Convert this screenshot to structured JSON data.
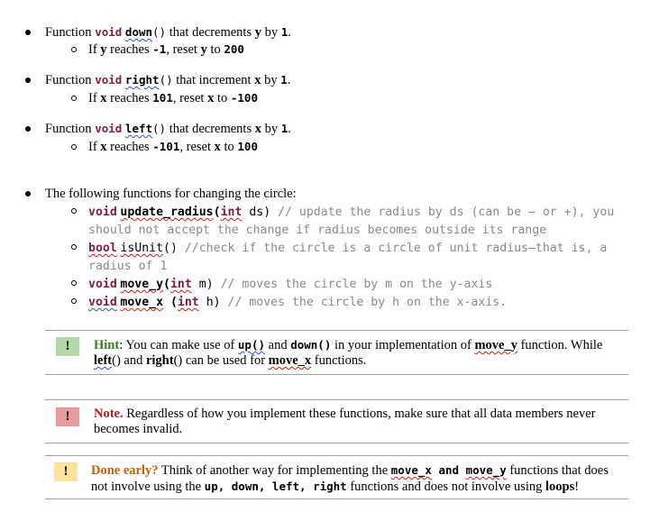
{
  "colors": {
    "keyword": "#7a1f4a",
    "comment": "#8a8a8a",
    "hint_label": "#3b7a23",
    "note_label": "#b02020",
    "done_label": "#c06010",
    "hint_icon_bg": "#b5d8a8",
    "note_icon_bg": "#e99a9c",
    "done_icon_bg": "#fde39c",
    "rule": "#a0a0a0"
  },
  "functions": [
    {
      "prefix": "Function ",
      "keyword": "void",
      "name": "down",
      "parens": "()",
      "suffix_text": " that decrements ",
      "var": "y",
      "by": " by ",
      "amount": "1",
      "end": ".",
      "sub": {
        "prefix": "If ",
        "var1": "y",
        "mid1": " reaches ",
        "val1": "-1",
        "mid2": ", reset ",
        "var2": "y",
        "mid3": " to ",
        "val2": "200"
      }
    },
    {
      "prefix": "Function ",
      "keyword": "void",
      "name": "right",
      "parens": "()",
      "suffix_text": " that increment ",
      "var": "x",
      "by": " by ",
      "amount": "1",
      "end": ".",
      "sub": {
        "prefix": "If ",
        "var1": "x",
        "mid1": " reaches ",
        "val1": "101",
        "mid2": ", reset ",
        "var2": "x",
        "mid3": " to ",
        "val2": "-100"
      }
    },
    {
      "prefix": "Function ",
      "keyword": "void",
      "name": "left",
      "parens": "()",
      "suffix_text": " that decrements ",
      "var": "x",
      "by": " by ",
      "amount": "1",
      "end": ".",
      "sub": {
        "prefix": "If ",
        "var1": "x",
        "mid1": " reaches ",
        "val1": "-101",
        "mid2": ", reset ",
        "var2": "x",
        "mid3": " to ",
        "val2": "100"
      }
    }
  ],
  "circle_section": {
    "intro": "The following functions for changing the circle:",
    "items": [
      {
        "type": "void",
        "name": "update_radius",
        "open": "(",
        "ptype": "int",
        "param": " ds)",
        "comment_l1": " // update the radius by ds (can be – or +), you",
        "comment_l2": "should not accept the change if radius becomes outside its range"
      },
      {
        "type": "bool",
        "name": "isUnit",
        "open": "()",
        "ptype": "",
        "param": "",
        "comment_l1": " //check if the circle is a circle of unit radius—that is, a",
        "comment_l2": "radius of 1"
      },
      {
        "type": "void",
        "name": "move_y",
        "open": "(",
        "ptype": "int",
        "param": " m)",
        "comment_l1": " // moves the circle by m on the y-axis"
      },
      {
        "type": "void",
        "name": "move_x",
        "open": " (",
        "ptype": "int",
        "param": " h)",
        "comment_l1": "   // moves the circle by h on the x-axis."
      }
    ]
  },
  "callouts": {
    "hint": {
      "icon": "!",
      "label": "Hint",
      "t1": ": You can make use of ",
      "c1": "up()",
      "t2": " and ",
      "c2": "down()",
      "t3": "  in your implementation of ",
      "c3": "move_y",
      "t4": " function. While ",
      "c4": "left",
      "t5": "() and ",
      "c5": "right",
      "t6": "() can be used for ",
      "c6": "move_x",
      "t7": " functions."
    },
    "note": {
      "icon": "!",
      "label": "Note.",
      "text": " Regardless of how you implement these functions, make sure that all data members never becomes invalid."
    },
    "done": {
      "icon": "!",
      "label": "Done early?",
      "t1": " Think of another way for implementing the ",
      "c1": "move_x",
      "c2": " and ",
      "c3": "move_y",
      "t2": " functions that does not involve using the ",
      "c4": "up, down, left, right",
      "t3": " functions and does not involve using ",
      "b1": "loops",
      "t4": "!"
    }
  }
}
